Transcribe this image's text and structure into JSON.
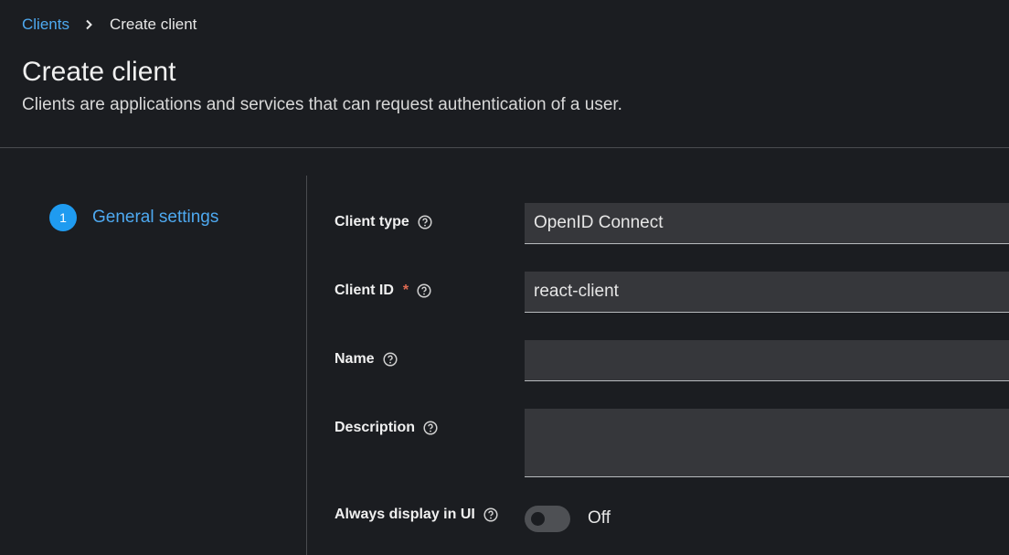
{
  "breadcrumb": {
    "parent": "Clients",
    "current": "Create client"
  },
  "header": {
    "title": "Create client",
    "subtitle": "Clients are applications and services that can request authentication of a user."
  },
  "wizard": {
    "steps": [
      {
        "number": "1",
        "label": "General settings"
      }
    ]
  },
  "form": {
    "client_type": {
      "label": "Client type",
      "value": "OpenID Connect"
    },
    "client_id": {
      "label": "Client ID",
      "required_marker": "*",
      "value": "react-client"
    },
    "name": {
      "label": "Name",
      "value": ""
    },
    "description": {
      "label": "Description",
      "value": ""
    },
    "always_display": {
      "label": "Always display in UI",
      "state_text": "Off"
    }
  },
  "colors": {
    "accent": "#1f9bf0",
    "link": "#4ea9f0",
    "background": "#1b1d21",
    "field_background": "#36373b",
    "required": "#e06b53"
  }
}
